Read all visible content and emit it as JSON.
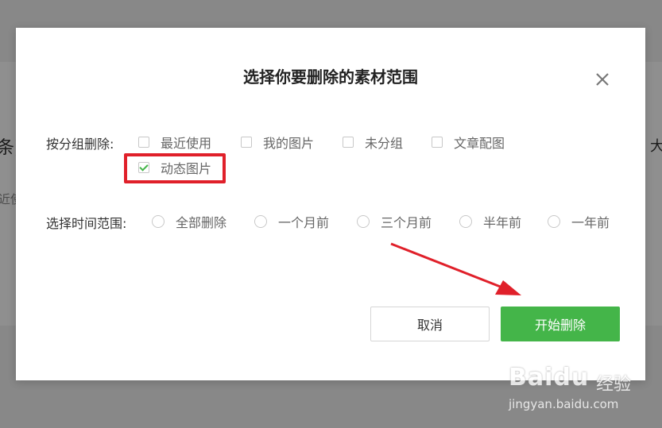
{
  "background": {
    "left_fragment_1": "条)",
    "left_fragment_2": "近使",
    "right_fragment": "大"
  },
  "dialog": {
    "title": "选择你要删除的素材范围",
    "close_icon": "close-icon",
    "group_row": {
      "label": "按分组删除:",
      "options": [
        {
          "label": "最近使用",
          "checked": false
        },
        {
          "label": "我的图片",
          "checked": false
        },
        {
          "label": "未分组",
          "checked": false
        },
        {
          "label": "文章配图",
          "checked": false
        },
        {
          "label": "动态图片",
          "checked": true
        }
      ]
    },
    "time_row": {
      "label": "选择时间范围:",
      "options": [
        {
          "label": "全部删除",
          "selected": false
        },
        {
          "label": "一个月前",
          "selected": false
        },
        {
          "label": "三个月前",
          "selected": false
        },
        {
          "label": "半年前",
          "selected": false
        },
        {
          "label": "一年前",
          "selected": false
        }
      ]
    },
    "buttons": {
      "cancel": "取消",
      "start": "开始删除"
    }
  },
  "colors": {
    "accent_green": "#44b549",
    "highlight_red": "#e0202a"
  },
  "watermark": {
    "brand": "Baidu",
    "sub": "经验",
    "url": "jingyan.baidu.com"
  }
}
